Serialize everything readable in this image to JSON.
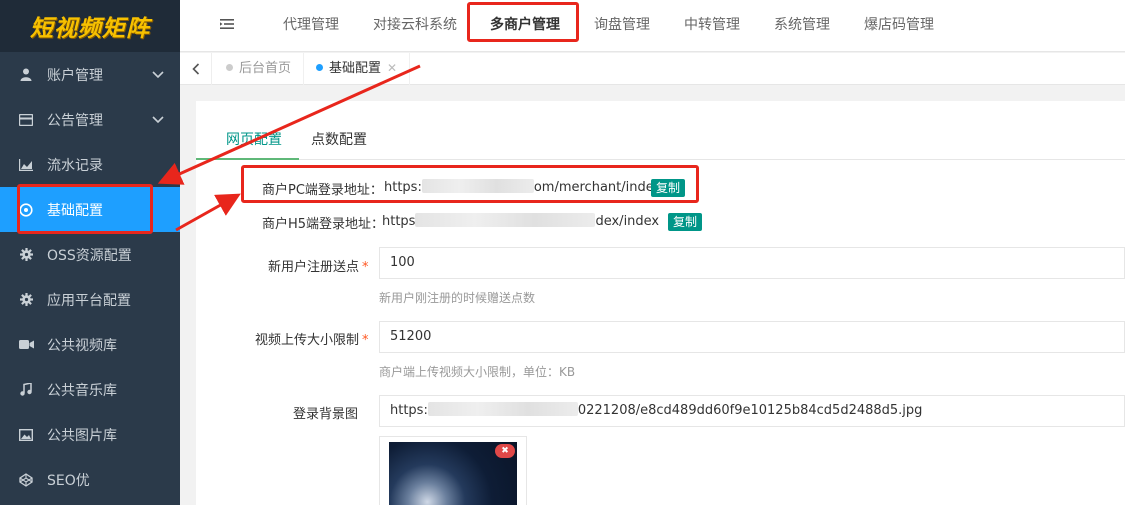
{
  "app": {
    "logo": "短视频矩阵"
  },
  "sidebar": {
    "items": [
      {
        "label": "账户管理",
        "icon": "user-icon",
        "expandable": true
      },
      {
        "label": "公告管理",
        "icon": "card-icon",
        "expandable": true
      },
      {
        "label": "流水记录",
        "icon": "chart-area-icon",
        "expandable": false
      },
      {
        "label": "基础配置",
        "icon": "settings-circle-icon",
        "expandable": false,
        "active": true
      },
      {
        "label": "OSS资源配置",
        "icon": "gear-icon",
        "expandable": false
      },
      {
        "label": "应用平台配置",
        "icon": "gear-icon",
        "expandable": false
      },
      {
        "label": "公共视频库",
        "icon": "video-camera-icon",
        "expandable": false
      },
      {
        "label": "公共音乐库",
        "icon": "music-note-icon",
        "expandable": false
      },
      {
        "label": "公共图片库",
        "icon": "image-icon",
        "expandable": false
      },
      {
        "label": "SEO优",
        "icon": "codepen-icon",
        "expandable": false
      }
    ]
  },
  "topnav": {
    "items": [
      "代理管理",
      "对接云科系统",
      "多商户管理",
      "询盘管理",
      "中转管理",
      "系统管理",
      "爆店码管理"
    ],
    "active_index": 2
  },
  "tabs": {
    "items": [
      {
        "label": "后台首页",
        "active": false
      },
      {
        "label": "基础配置",
        "active": true,
        "closable": true
      }
    ]
  },
  "form": {
    "subtabs": [
      "网页配置",
      "点数配置"
    ],
    "active_subtab": 0,
    "pc_login": {
      "label": "商户PC端登录地址：",
      "prefix": "https:",
      "suffix": "om/merchant/index",
      "copy_label": "复制"
    },
    "h5_login": {
      "label": "商户H5端登录地址：",
      "prefix": "https",
      "suffix": "dex/index",
      "copy_label": "复制"
    },
    "register_points": {
      "label": "新用户注册送点",
      "required": "*",
      "value": "100",
      "hint": "新用户刚注册的时候赠送点数"
    },
    "upload_limit": {
      "label": "视频上传大小限制",
      "required": "*",
      "value": "51200",
      "hint": "商户端上传视频大小限制，单位：KB"
    },
    "login_bg": {
      "label": "登录背景图",
      "url_prefix": "https:",
      "url_suffix": "0221208/e8cd489dd60f9e10125b84cd5d2488d5.jpg"
    }
  },
  "colors": {
    "sidebar_bg": "#2b3a4a",
    "active_blue": "#1e9fff",
    "accent_green": "#009688",
    "annotation_red": "#e8261c",
    "logo_yellow": "#f7c100"
  }
}
